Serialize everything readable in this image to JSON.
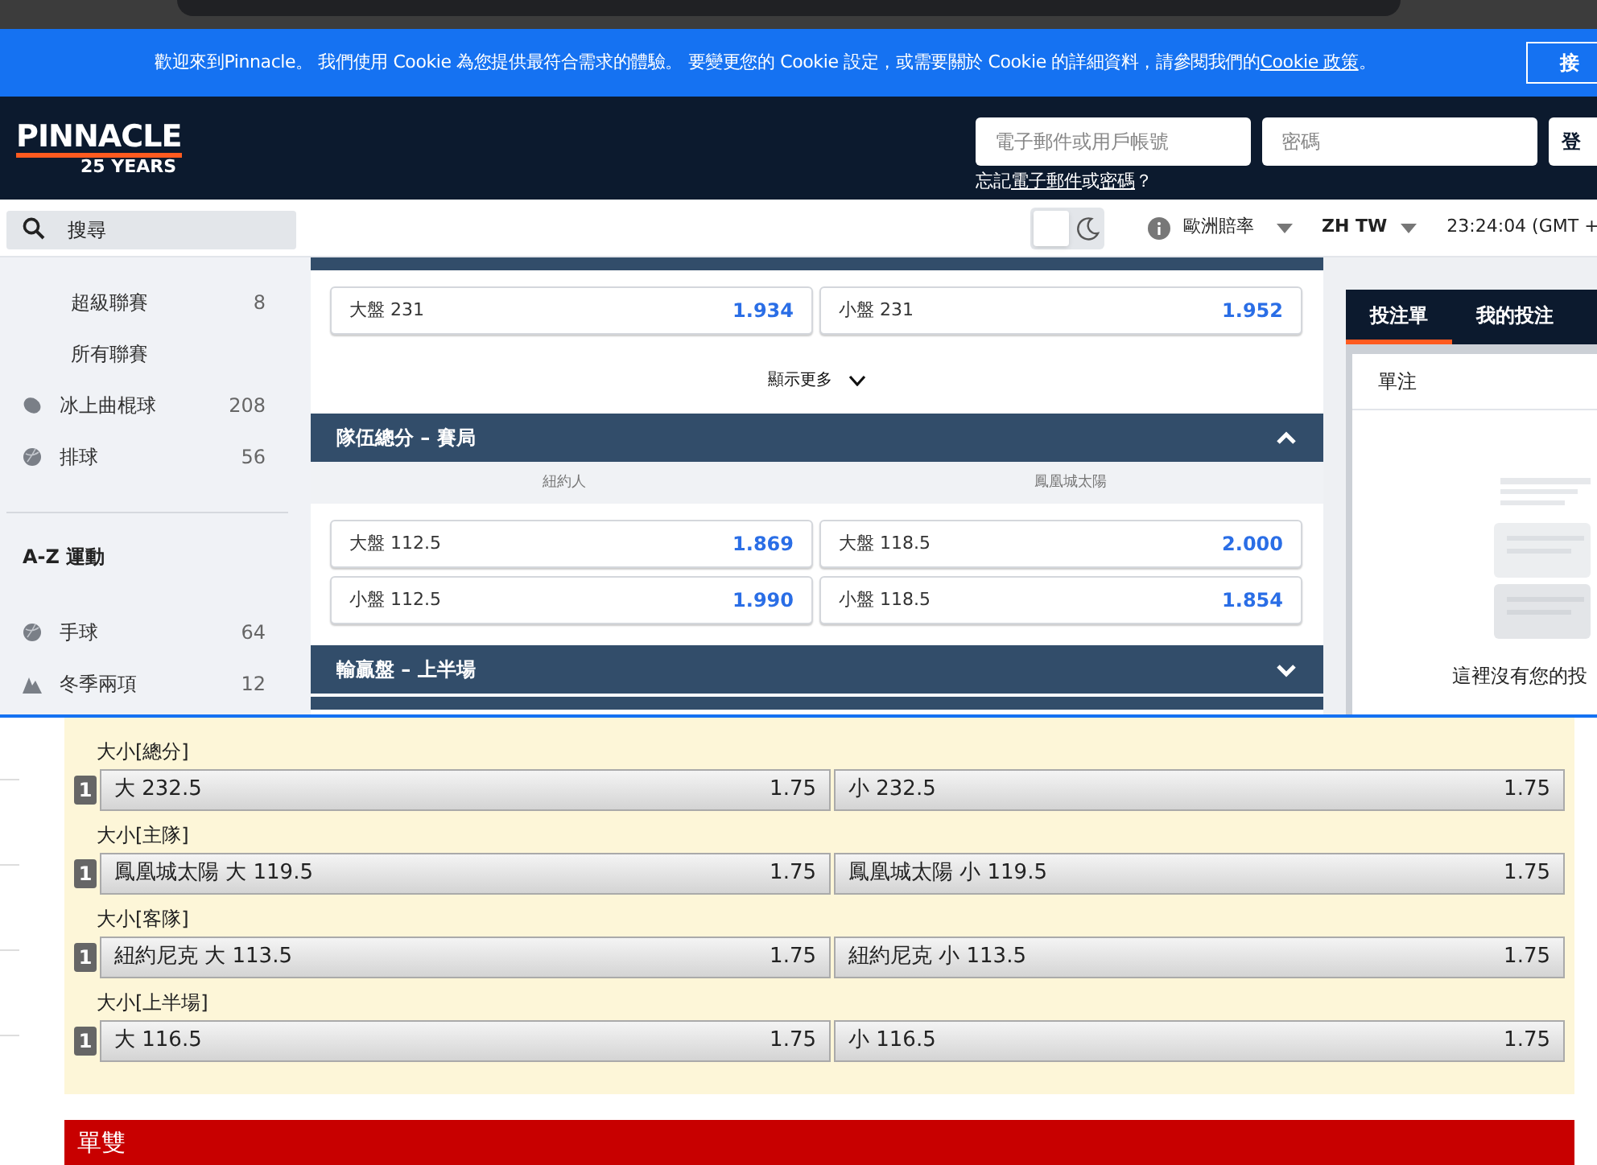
{
  "cookie_banner": {
    "text": "歡迎來到Pinnacle。 我們使用 Cookie 為您提供最符合需求的體驗。 要變更您的 Cookie 設定，或需要關於 Cookie 的詳細資料，請參閱我們的",
    "link": "Cookie 政策",
    "end": "。",
    "button": "接"
  },
  "header": {
    "logo": "PINNACLE",
    "logo_sub": "25 YEARS",
    "email_placeholder": "電子郵件或用戶帳號",
    "password_placeholder": "密碼",
    "login": "登",
    "forgot_prefix": "忘記",
    "forgot_email": "電子郵件",
    "forgot_or": "或",
    "forgot_password": "密碼",
    "forgot_suffix": "？"
  },
  "toolbar": {
    "search_placeholder": "搜尋",
    "dark_mode": false,
    "odds_format": "歐洲賠率",
    "language": "ZH TW",
    "time": "23:24:04 (GMT +"
  },
  "sidebar": {
    "items": [
      {
        "kind": "league",
        "label": "超級聯賽",
        "count": "8"
      },
      {
        "kind": "league",
        "label": "所有聯賽"
      },
      {
        "kind": "puck",
        "label": "冰上曲棍球",
        "count": "208"
      },
      {
        "kind": "ball",
        "label": "排球",
        "count": "56"
      },
      {
        "kind": "divider"
      },
      {
        "kind": "heading",
        "label": "A-Z 運動"
      },
      {
        "kind": "ball",
        "label": "手球",
        "count": "64"
      },
      {
        "kind": "peak",
        "label": "冬季兩項",
        "count": "12"
      }
    ]
  },
  "markets": [
    {
      "kind": "rows",
      "rows": [
        [
          {
            "label": "大盤 231",
            "odds": "1.934"
          },
          {
            "label": "小盤 231",
            "odds": "1.952"
          }
        ]
      ]
    },
    {
      "kind": "more",
      "label": "顯示更多"
    },
    {
      "kind": "header",
      "title": "隊伍總分 – 賽局",
      "expanded": true
    },
    {
      "kind": "teams",
      "teams": [
        "紐約人",
        "鳳凰城太陽"
      ]
    },
    {
      "kind": "rows",
      "rows": [
        [
          {
            "label": "大盤 112.5",
            "odds": "1.869"
          },
          {
            "label": "大盤 118.5",
            "odds": "2.000"
          }
        ],
        [
          {
            "label": "小盤 112.5",
            "odds": "1.990"
          },
          {
            "label": "小盤 118.5",
            "odds": "1.854"
          }
        ]
      ]
    },
    {
      "kind": "header",
      "title": "輸贏盤 – 上半場",
      "expanded": false
    }
  ],
  "betslip": {
    "tabs": [
      {
        "label": "投注單",
        "selected": true
      },
      {
        "label": "我的投注",
        "selected": false
      }
    ],
    "type": "單注",
    "empty_text": "這裡沒有您的投"
  },
  "second_site": {
    "groups": [
      {
        "title": "大小[總分]",
        "badge": "1",
        "options": [
          {
            "label": "大 232.5",
            "odds": "1.75"
          },
          {
            "label": "小 232.5",
            "odds": "1.75"
          }
        ]
      },
      {
        "title": "大小[主隊]",
        "badge": "1",
        "options": [
          {
            "label": "鳳凰城太陽 大 119.5",
            "odds": "1.75"
          },
          {
            "label": "鳳凰城太陽 小 119.5",
            "odds": "1.75"
          }
        ]
      },
      {
        "title": "大小[客隊]",
        "badge": "1",
        "options": [
          {
            "label": "紐約尼克 大 113.5",
            "odds": "1.75"
          },
          {
            "label": "紐約尼克 小 113.5",
            "odds": "1.75"
          }
        ]
      },
      {
        "title": "大小[上半場]",
        "badge": "1",
        "options": [
          {
            "label": "大 116.5",
            "odds": "1.75"
          },
          {
            "label": "小 116.5",
            "odds": "1.75"
          }
        ]
      }
    ],
    "section": "單雙"
  }
}
